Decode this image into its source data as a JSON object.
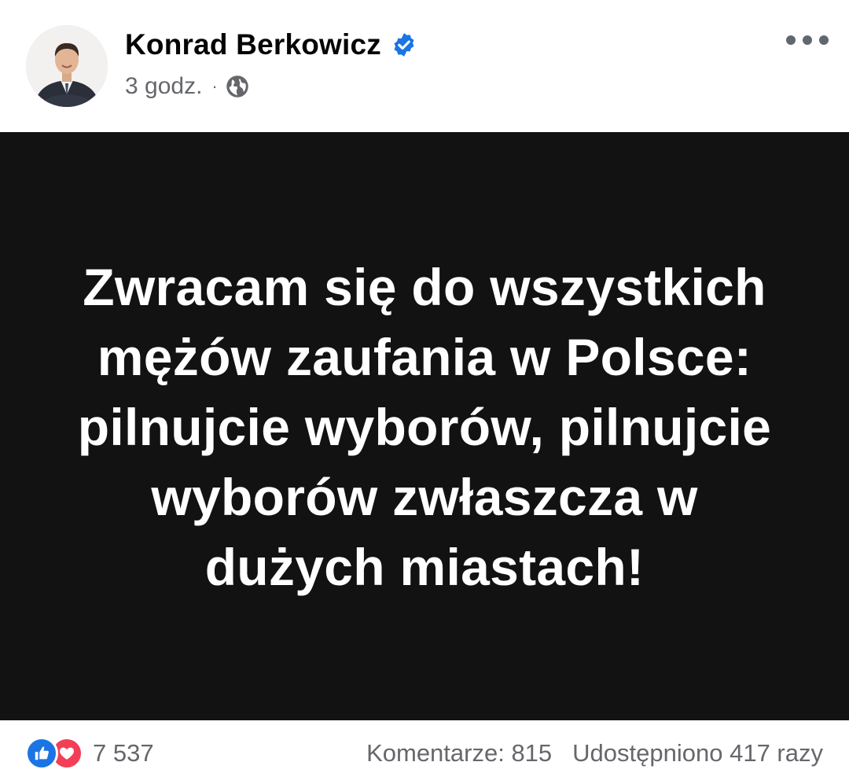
{
  "post": {
    "author": "Konrad Berkowicz",
    "verified": true,
    "time": "3 godz.",
    "separator": "·",
    "audience_icon": "globe-icon",
    "menu_icon": "more-options-icon"
  },
  "content": {
    "lines": [
      "Zwracam się do wszystkich",
      "mężów zaufania w Polsce:",
      "pilnujcie wyborów, pilnujcie",
      "wyborów zwłaszcza w",
      "dużych miastach!"
    ],
    "background_color": "#121212",
    "text_color": "#ffffff"
  },
  "footer": {
    "reaction_icons": [
      "like-icon",
      "love-icon"
    ],
    "reaction_count": "7 537",
    "comments": "Komentarze: 815",
    "shares": "Udostępniono 417 razy"
  },
  "colors": {
    "verified_blue": "#1b74e4",
    "like_blue": "#1b74e4",
    "love_red": "#f33e58",
    "meta_gray": "#65676b"
  }
}
